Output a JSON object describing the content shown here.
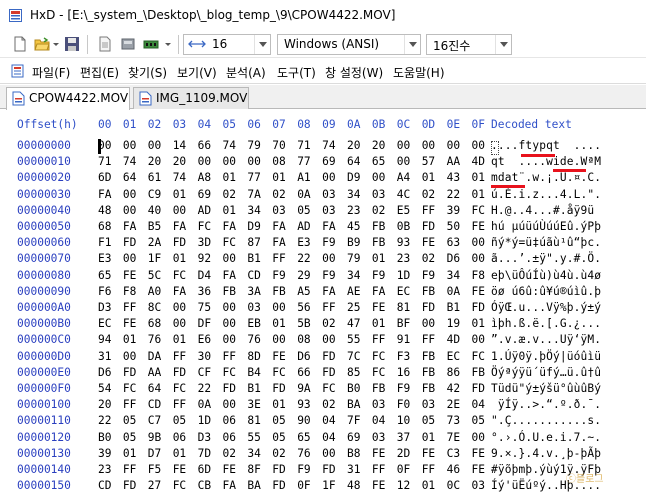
{
  "window": {
    "title": "HxD - [E:\\_system_\\Desktop\\_blog_temp_\\9\\CPOW4422.MOV]"
  },
  "toolbar": {
    "bytes_per_row": "16",
    "charset": "Windows (ANSI)",
    "number_base": "16진수"
  },
  "menu": {
    "items": [
      "파일(F)",
      "편집(E)",
      "찾기(S)",
      "보기(V)",
      "분석(A)",
      "도구(T)",
      "창 설정(W)",
      "도움말(H)"
    ]
  },
  "tabs": [
    {
      "label": "CPOW4422.MOV",
      "active": true
    },
    {
      "label": "IMG_1109.MOV",
      "active": false
    }
  ],
  "editor": {
    "offset_header": "Offset(h)",
    "column_headers": [
      "00",
      "01",
      "02",
      "03",
      "04",
      "05",
      "06",
      "07",
      "08",
      "09",
      "0A",
      "0B",
      "0C",
      "0D",
      "0E",
      "0F"
    ],
    "decoded_header": "Decoded text",
    "rows": [
      {
        "offset": "00000000",
        "hex": [
          "00",
          "00",
          "00",
          "14",
          "66",
          "74",
          "79",
          "70",
          "71",
          "74",
          "20",
          "20",
          "00",
          "00",
          "00",
          "00"
        ],
        "text": "....ftypqt  ...."
      },
      {
        "offset": "00000010",
        "hex": [
          "71",
          "74",
          "20",
          "20",
          "00",
          "00",
          "00",
          "08",
          "77",
          "69",
          "64",
          "65",
          "00",
          "57",
          "AA",
          "4D"
        ],
        "text": "qt  ....wide.WªM"
      },
      {
        "offset": "00000020",
        "hex": [
          "6D",
          "64",
          "61",
          "74",
          "A8",
          "01",
          "77",
          "01",
          "A1",
          "00",
          "D9",
          "00",
          "A4",
          "01",
          "43",
          "01"
        ],
        "text": "mdat¨.w.¡.Ù.¤.C."
      },
      {
        "offset": "00000030",
        "hex": [
          "FA",
          "00",
          "C9",
          "01",
          "69",
          "02",
          "7A",
          "02",
          "0A",
          "03",
          "34",
          "03",
          "4C",
          "02",
          "22",
          "01"
        ],
        "text": "ú.É.i.z...4.L.\"."
      },
      {
        "offset": "00000040",
        "hex": [
          "48",
          "00",
          "40",
          "00",
          "AD",
          "01",
          "34",
          "03",
          "05",
          "03",
          "23",
          "02",
          "E5",
          "FF",
          "39",
          "FC"
        ],
        "text": "H.@.­.4...#.åÿ9ü"
      },
      {
        "offset": "00000050",
        "hex": [
          "68",
          "FA",
          "B5",
          "FA",
          "FC",
          "FA",
          "D9",
          "FA",
          "AD",
          "FA",
          "45",
          "FB",
          "0B",
          "FD",
          "50",
          "FE"
        ],
        "text": "hú µúüúÙú­úEû.ýPþ"
      },
      {
        "offset": "00000060",
        "hex": [
          "F1",
          "FD",
          "2A",
          "FD",
          "3D",
          "FC",
          "87",
          "FA",
          "E3",
          "F9",
          "B9",
          "FB",
          "93",
          "FE",
          "63",
          "00"
        ],
        "text": "ñý*ý=ü‡úãù¹û“þc."
      },
      {
        "offset": "00000070",
        "hex": [
          "E3",
          "00",
          "1F",
          "01",
          "92",
          "00",
          "B1",
          "FF",
          "22",
          "00",
          "79",
          "01",
          "23",
          "02",
          "D6",
          "00"
        ],
        "text": "ã...’.±ÿ\".y.#.Ö."
      },
      {
        "offset": "00000080",
        "hex": [
          "65",
          "FE",
          "5C",
          "FC",
          "D4",
          "FA",
          "CD",
          "F9",
          "29",
          "F9",
          "34",
          "F9",
          "1D",
          "F9",
          "34",
          "F8"
        ],
        "text": "eþ\\üÔúÍù)ù4ù.ù4ø"
      },
      {
        "offset": "00000090",
        "hex": [
          "F6",
          "F8",
          "A0",
          "FA",
          "36",
          "FB",
          "3A",
          "FB",
          "A5",
          "FA",
          "AE",
          "FA",
          "EC",
          "FB",
          "0A",
          "FE"
        ],
        "text": "öø ú6û:û¥ú®úìû.þ"
      },
      {
        "offset": "000000A0",
        "hex": [
          "D3",
          "FF",
          "8C",
          "00",
          "75",
          "00",
          "03",
          "00",
          "56",
          "FF",
          "25",
          "FE",
          "81",
          "FD",
          "B1",
          "FD"
        ],
        "text": "ÓÿŒ.u...Vÿ%þ.ý±ý"
      },
      {
        "offset": "000000B0",
        "hex": [
          "EC",
          "FE",
          "68",
          "00",
          "DF",
          "00",
          "EB",
          "01",
          "5B",
          "02",
          "47",
          "01",
          "BF",
          "00",
          "19",
          "01"
        ],
        "text": "ìþh.ß.ë.[.G.¿..."
      },
      {
        "offset": "000000C0",
        "hex": [
          "94",
          "01",
          "76",
          "01",
          "E6",
          "00",
          "76",
          "00",
          "08",
          "00",
          "55",
          "FF",
          "91",
          "FF",
          "4D",
          "00"
        ],
        "text": "”.v.æ.v...Uÿ‘ÿM."
      },
      {
        "offset": "000000D0",
        "hex": [
          "31",
          "00",
          "DA",
          "FF",
          "30",
          "FF",
          "8D",
          "FE",
          "D6",
          "FD",
          "7C",
          "FC",
          "F3",
          "FB",
          "EC",
          "FC"
        ],
        "text": "1.Úÿ0ÿ.þÖý|üóûìü"
      },
      {
        "offset": "000000E0",
        "hex": [
          "D6",
          "FD",
          "AA",
          "FD",
          "CF",
          "FC",
          "B4",
          "FC",
          "66",
          "FD",
          "85",
          "FC",
          "16",
          "FB",
          "86",
          "FB"
        ],
        "text": "Öýªýÿü´üfý…ü.û†û"
      },
      {
        "offset": "000000F0",
        "hex": [
          "54",
          "FC",
          "64",
          "FC",
          "22",
          "FD",
          "B1",
          "FD",
          "9A",
          "FC",
          "B0",
          "FB",
          "F9",
          "FB",
          "42",
          "FD"
        ],
        "text": "Tüdü\"ý±ýšü°ûùûBý"
      },
      {
        "offset": "00000100",
        "hex": [
          "20",
          "FF",
          "CD",
          "FF",
          "0A",
          "00",
          "3E",
          "01",
          "93",
          "02",
          "BA",
          "03",
          "F0",
          "03",
          "2E",
          "04"
        ],
        "text": " ÿÍÿ..>.“.º.ð.¯."
      },
      {
        "offset": "00000110",
        "hex": [
          "22",
          "05",
          "C7",
          "05",
          "1D",
          "06",
          "81",
          "05",
          "90",
          "04",
          "7F",
          "04",
          "10",
          "05",
          "73",
          "05"
        ],
        "text": "\".Ç...........s."
      },
      {
        "offset": "00000120",
        "hex": [
          "B0",
          "05",
          "9B",
          "06",
          "D3",
          "06",
          "55",
          "05",
          "65",
          "04",
          "69",
          "03",
          "37",
          "01",
          "7E",
          "00"
        ],
        "text": "°.›.Ó.U.e.i.7.~."
      },
      {
        "offset": "00000130",
        "hex": [
          "39",
          "01",
          "D7",
          "01",
          "7D",
          "02",
          "34",
          "02",
          "76",
          "00",
          "B8",
          "FE",
          "2D",
          "FE",
          "C3",
          "FE"
        ],
        "text": "9.×.}.4.v.¸þ-þÃþ"
      },
      {
        "offset": "00000140",
        "hex": [
          "23",
          "FF",
          "F5",
          "FE",
          "6D",
          "FE",
          "8F",
          "FD",
          "F9",
          "FD",
          "31",
          "FF",
          "0F",
          "FF",
          "46",
          "FE"
        ],
        "text": "#ÿõþmþ.ýùý1ÿ.ÿFþ"
      },
      {
        "offset": "00000150",
        "hex": [
          "CD",
          "FD",
          "27",
          "FC",
          "CB",
          "FA",
          "BA",
          "FD",
          "0F",
          "1F",
          "48",
          "FE",
          "12",
          "01",
          "0C",
          "03"
        ],
        "text": "Íý'üËúºý..Hþ...."
      }
    ]
  },
  "watermark": "ⓒ블로그"
}
